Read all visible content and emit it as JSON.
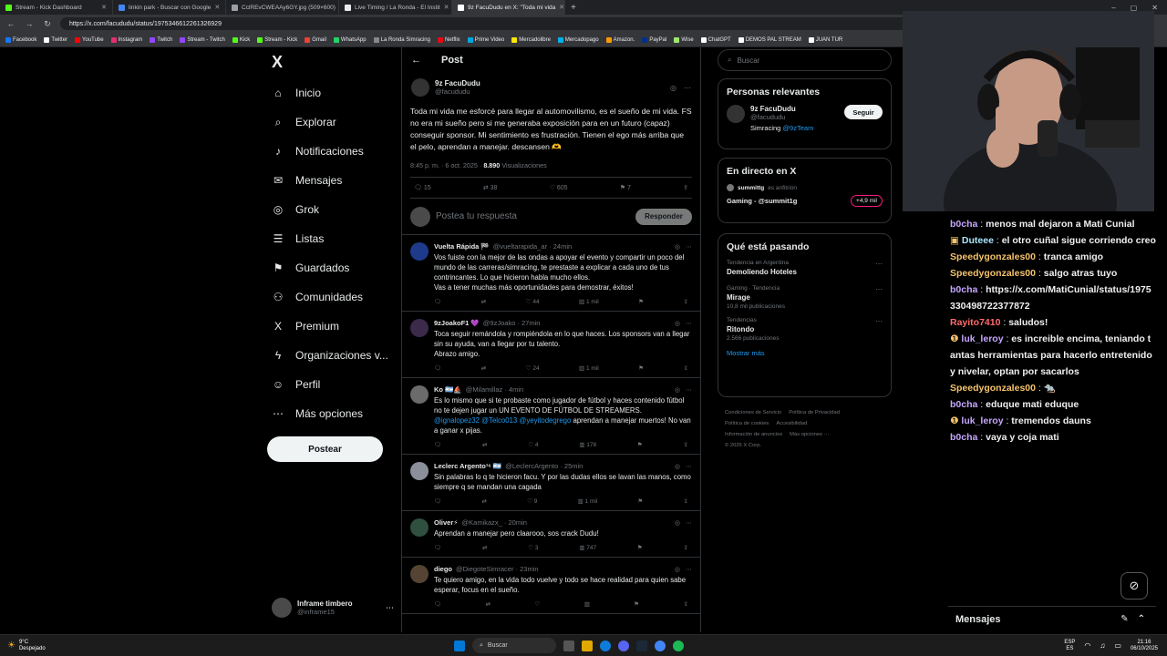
{
  "browser": {
    "tabs": [
      {
        "title": "Stream - Kick Dashboard",
        "color": "#53fc18"
      },
      {
        "title": "linkin park - Buscar con Google",
        "color": "#4285f4"
      },
      {
        "title": "CclREvCWEAAy6GY.jpg (509×600)",
        "color": "#9aa0a6"
      },
      {
        "title": "Live Timing / La Ronda - El Instit",
        "color": "#e8eaed"
      },
      {
        "title": "9z FacuDudu en X: \"Toda mi vida",
        "color": "#ffffff"
      }
    ],
    "new_tab": "+",
    "url": "https://x.com/facududu/status/1975346612261326929",
    "bookmarks": [
      {
        "label": "Facebook",
        "color": "#1877f2"
      },
      {
        "label": "Twitter",
        "color": "#ffffff"
      },
      {
        "label": "YouTube",
        "color": "#ff0000"
      },
      {
        "label": "Instagram",
        "color": "#e1306c"
      },
      {
        "label": "Twitch",
        "color": "#9146ff"
      },
      {
        "label": "Stream - Twitch",
        "color": "#9146ff"
      },
      {
        "label": "Kick",
        "color": "#53fc18"
      },
      {
        "label": "Stream - Kick",
        "color": "#53fc18"
      },
      {
        "label": "Gmail",
        "color": "#ea4335"
      },
      {
        "label": "WhatsApp",
        "color": "#25d366"
      },
      {
        "label": "La Ronda Simracing",
        "color": "#888888"
      },
      {
        "label": "Netflix",
        "color": "#e50914"
      },
      {
        "label": "Prime Video",
        "color": "#00a8e1"
      },
      {
        "label": "Mercadolibre",
        "color": "#ffe600"
      },
      {
        "label": "Mercadopago",
        "color": "#00b1ea"
      },
      {
        "label": "Amazon.",
        "color": "#ff9900"
      },
      {
        "label": "PayPal",
        "color": "#003087"
      },
      {
        "label": "Wise",
        "color": "#9fe870"
      },
      {
        "label": "ChatGPT",
        "color": "#ffffff"
      },
      {
        "label": "DEMOS PAL STREAM",
        "color": "#ffffff"
      },
      {
        "label": "JUAN TUR",
        "color": "#ffffff"
      }
    ]
  },
  "sidebar": {
    "logo": "X",
    "items": [
      {
        "label": "Inicio",
        "icon": "⌂"
      },
      {
        "label": "Explorar",
        "icon": "⌕"
      },
      {
        "label": "Notificaciones",
        "icon": "♪"
      },
      {
        "label": "Mensajes",
        "icon": "✉"
      },
      {
        "label": "Grok",
        "icon": "◎"
      },
      {
        "label": "Listas",
        "icon": "☰"
      },
      {
        "label": "Guardados",
        "icon": "⚑"
      },
      {
        "label": "Comunidades",
        "icon": "⚇"
      },
      {
        "label": "Premium",
        "icon": "X"
      },
      {
        "label": "Organizaciones v...",
        "icon": "ϟ"
      },
      {
        "label": "Perfil",
        "icon": "☺"
      },
      {
        "label": "Más opciones",
        "icon": "⋯"
      }
    ],
    "post_button": "Postear",
    "account": {
      "name": "Inframe timbero",
      "handle": "@inframe15",
      "more": "⋯"
    }
  },
  "main": {
    "back": "←",
    "title": "Post",
    "post": {
      "author": "9z FacuDudu",
      "handle": "@facududu",
      "text": "Toda mi vida me esforcé para llegar al automovilismo, es el sueño de mi vida. FS no era mi sueño pero si me generaba exposición para en un futuro (capaz) conseguir sponsor. Mi sentimiento es frustración. Tienen el ego más arriba que el pelo, aprendan a manejar. descansen 🫶",
      "time": "8:45 p. m. · 6 oct. 2025 ·",
      "views": "8.890",
      "views_label": "Visualizaciones",
      "replies": "15",
      "reposts": "38",
      "likes": "605",
      "bookmarks": "7"
    },
    "reply_placeholder": "Postea tu respuesta",
    "reply_button": "Responder",
    "replies": [
      {
        "name": "Vuelta Rápida 🏁",
        "handle": "@vueltarapida_ar · 24min",
        "text": "Vos fuiste con la mejor de las ondas a apoyar el evento y compartir un poco del mundo de las carreras/simracing, te prestaste a explicar a cada uno de tus contrincantes. Lo que hicieron habla mucho ellos.\nVas a tener muchas más oportunidades para demostrar, éxitos!",
        "link": "",
        "after": "",
        "replies": "",
        "reposts": "",
        "likes": "44",
        "views": "1 mil",
        "avatar": "#1e3a8a"
      },
      {
        "name": "9zJoakoF1 💜",
        "handle": "@9zJoako · 27min",
        "text": "Toca seguir remándola y rompiéndola en lo que haces. Los sponsors van a llegar sin su ayuda, van a llegar por tu talento.\nAbrazo amigo.",
        "link": "",
        "after": "",
        "replies": "",
        "reposts": "",
        "likes": "24",
        "views": "1 mil",
        "avatar": "#3b2a4a"
      },
      {
        "name": "Ko 🇦🇷⛵",
        "handle": "@Milamillaz · 4min",
        "text": "Es lo mismo que si te probaste como jugador de fútbol y haces contenido fútbol no te dejen jugar un UN EVENTO DE FÚTBOL DE STREAMERS.",
        "link": "@ignalopez32 @Telco013 @yeyitodegrego",
        "after": " aprendan a manejar muertos! No van a ganar x pijas.",
        "replies": "",
        "reposts": "",
        "likes": "4",
        "views": "178",
        "avatar": "#6b6b6b"
      },
      {
        "name": "Leclerc Argento¹⁶ 🇦🇷",
        "handle": "@LeclercArgento · 25min",
        "text": "Sin palabras lo q te hicieron facu. Y por las dudas ellos se lavan las manos, como siempre q se mandan una cagada",
        "link": "",
        "after": "",
        "replies": "",
        "reposts": "",
        "likes": "9",
        "views": "1 mil",
        "avatar": "#8a8f99"
      },
      {
        "name": "Oliver⚡",
        "handle": "@Kamikazx_ · 20min",
        "text": "Aprendan a manejar pero claarooo, sos crack Dudu!",
        "link": "",
        "after": "",
        "replies": "",
        "reposts": "",
        "likes": "3",
        "views": "747",
        "avatar": "#2f4f3f"
      },
      {
        "name": "diego",
        "handle": "@DiegoteSimracer · 23min",
        "text": "Te quiero amigo, en la vida todo vuelve y todo se hace realidad para quien sabe esperar, focus en el sueño.",
        "link": "",
        "after": "",
        "replies": "",
        "reposts": "",
        "likes": "",
        "views": "",
        "avatar": "#554433"
      }
    ]
  },
  "right": {
    "search_placeholder": "Buscar",
    "relevant_title": "Personas relevantes",
    "relevant": {
      "name": "9z FacuDudu",
      "handle": "@facududu",
      "bio": "Simracing ",
      "bio_link": "@9zTeam",
      "follow": "Seguir"
    },
    "live_title": "En directo en X",
    "live": {
      "host": "summittg",
      "host_note": "es anfitrión",
      "title": "Gaming - @summit1g",
      "count": "+4,9 mil"
    },
    "trends_title": "Qué está pasando",
    "trends": [
      {
        "context": "Tendencia en Argentina",
        "name": "Demoliendo Hoteles",
        "posts": ""
      },
      {
        "context": "Gaming · Tendencia",
        "name": "Mirage",
        "posts": "10,8 mil publicaciones"
      },
      {
        "context": "Tendencias",
        "name": "Ritondo",
        "posts": "2.566 publicaciones"
      }
    ],
    "show_more": "Mostrar más",
    "footer": [
      "Condiciones de Servicio",
      "Política de Privacidad",
      "Política de cookies",
      "Accesibilidad",
      "Información de anuncios",
      "Más opciones ···",
      "© 2025 X Corp."
    ]
  },
  "chat": {
    "messages": [
      {
        "user": "b0cha",
        "color": "#c6a7ff",
        "text": "menos mal dejaron a Mati Cunial",
        "badge": ""
      },
      {
        "user": "Duteee",
        "color": "#a8e6ff",
        "text": "el otro cuñal sigue corriendo creo",
        "badge": "▣"
      },
      {
        "user": "Speedygonzales00",
        "color": "#f5c36b",
        "text": "tranca amigo",
        "badge": ""
      },
      {
        "user": "Speedygonzales00",
        "color": "#f5c36b",
        "text": "salgo atras tuyo",
        "badge": ""
      },
      {
        "user": "b0cha",
        "color": "#c6a7ff",
        "text": "https://x.com/MatiCunial/status/1975330498722377872",
        "badge": ""
      },
      {
        "user": "Rayito7410",
        "color": "#ff6b6b",
        "text": "saludos!",
        "badge": ""
      },
      {
        "user": "luk_leroy",
        "color": "#c6a7ff",
        "text": "es increible encima, teniando tantas herramientas para hacerlo entretenido y nivelar, optan por sacarlos",
        "badge": "❶"
      },
      {
        "user": "Speedygonzales00",
        "color": "#f5c36b",
        "text": "🐀",
        "badge": ""
      },
      {
        "user": "b0cha",
        "color": "#c6a7ff",
        "text": "eduque mati eduque",
        "badge": ""
      },
      {
        "user": "luk_leroy",
        "color": "#c6a7ff",
        "text": "tremendos dauns",
        "badge": "❶"
      },
      {
        "user": "b0cha",
        "color": "#c6a7ff",
        "text": "vaya y coja mati",
        "badge": ""
      }
    ],
    "panel_title": "Mensajes"
  },
  "taskbar": {
    "temp": "9°C",
    "condition": "Despejado",
    "search": "Buscar",
    "lang": "ESP",
    "region": "ES",
    "time": "21:16",
    "date": "06/10/2025"
  }
}
